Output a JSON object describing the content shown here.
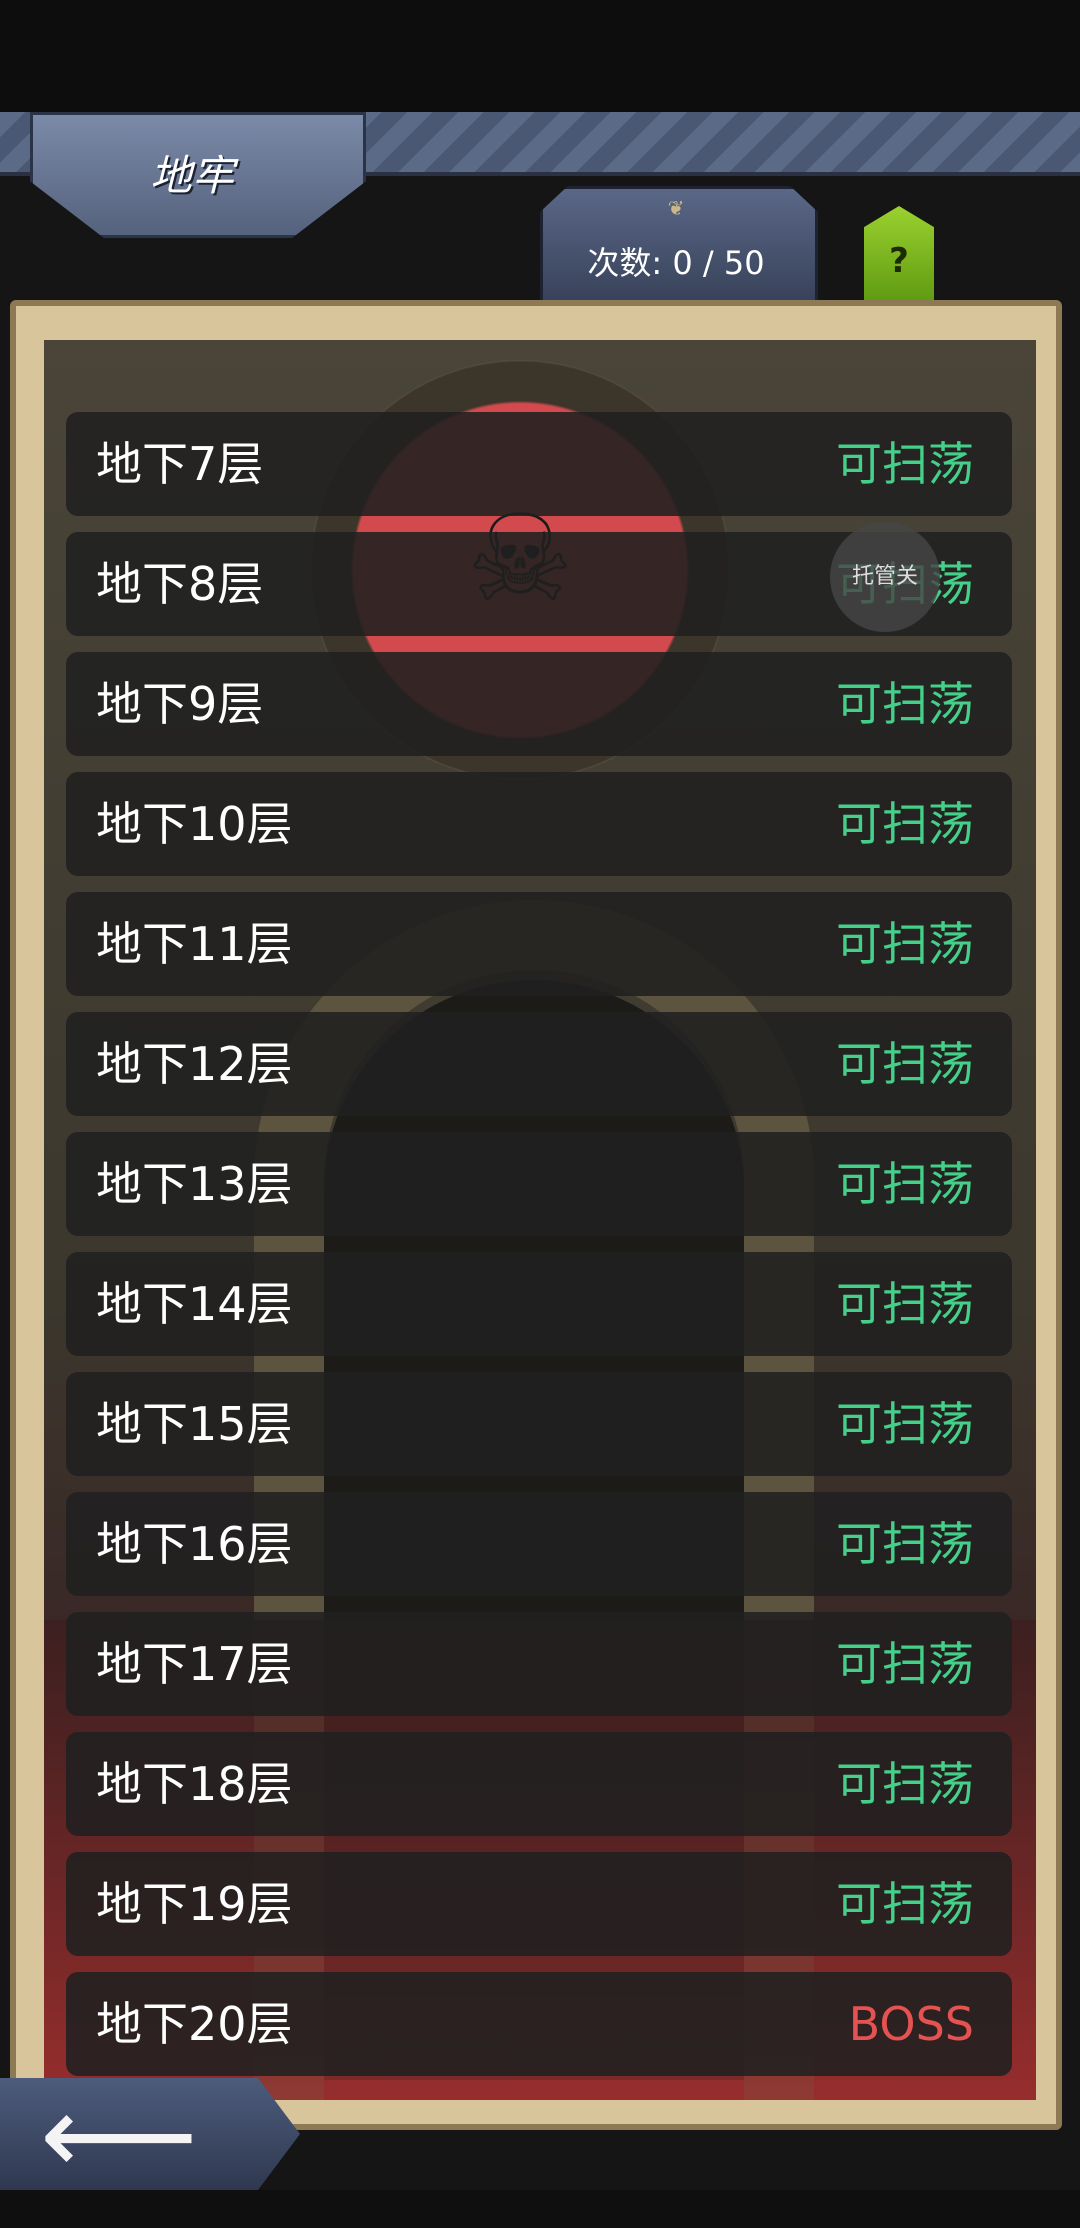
{
  "header": {
    "title": "地牢",
    "count_label": "次数: 0 / 50",
    "help_label": "?"
  },
  "floating_control": {
    "label": "托管关"
  },
  "colors": {
    "sweepable": "#45d08a",
    "boss": "#e55252"
  },
  "floors": [
    {
      "name": "地下7层",
      "status": "可扫荡",
      "type": "sweepable"
    },
    {
      "name": "地下8层",
      "status": "可扫荡",
      "type": "sweepable"
    },
    {
      "name": "地下9层",
      "status": "可扫荡",
      "type": "sweepable"
    },
    {
      "name": "地下10层",
      "status": "可扫荡",
      "type": "sweepable"
    },
    {
      "name": "地下11层",
      "status": "可扫荡",
      "type": "sweepable"
    },
    {
      "name": "地下12层",
      "status": "可扫荡",
      "type": "sweepable"
    },
    {
      "name": "地下13层",
      "status": "可扫荡",
      "type": "sweepable"
    },
    {
      "name": "地下14层",
      "status": "可扫荡",
      "type": "sweepable"
    },
    {
      "name": "地下15层",
      "status": "可扫荡",
      "type": "sweepable"
    },
    {
      "name": "地下16层",
      "status": "可扫荡",
      "type": "sweepable"
    },
    {
      "name": "地下17层",
      "status": "可扫荡",
      "type": "sweepable"
    },
    {
      "name": "地下18层",
      "status": "可扫荡",
      "type": "sweepable"
    },
    {
      "name": "地下19层",
      "status": "可扫荡",
      "type": "sweepable"
    },
    {
      "name": "地下20层",
      "status": "BOSS",
      "type": "boss"
    }
  ]
}
